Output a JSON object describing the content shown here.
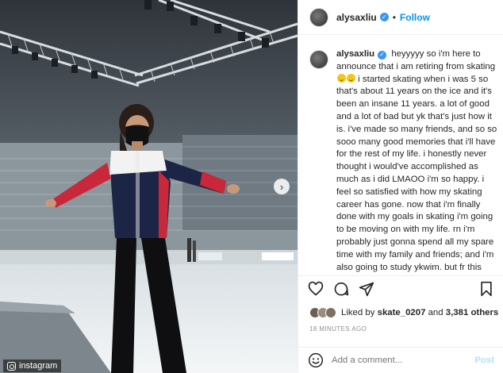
{
  "photo": {
    "watermark_text": "instagram",
    "carousel_icon": "chevron-right-icon",
    "arena_colors": {
      "roof": "#3a3f45",
      "seats": "#7f8a92",
      "ice": "#e4e9ec",
      "jacket_red": "#c8283a",
      "jacket_navy": "#1d2546",
      "jacket_white": "#f2f2f2"
    }
  },
  "post": {
    "username": "alysaxliu",
    "follow_label": "Follow",
    "separator": "•",
    "caption_part1": "heyyyyy so i'm here to announce that i am retiring from skating",
    "caption_part2": "i started skating when i was 5 so that's about 11 years on the ice and it's been an insane 11 years. a lot of good and a lot of bad but yk that's just how it is. i've made so many friends, and so so sooo many good memories that i'll have for the rest of my life. i honestly never thought i would've accomplished as much as i did LMAOO i'm so happy. i feel so satisfied with how my skating career has gone. now that i'm finally done with my goals in skating i'm going to be moving on with my life. rn i'm probably just gonna spend all my spare time with my family and friends; and i'm also going to study ykwim. but fr this skating thing has taught me a lot more",
    "liked_prefix": "Liked by",
    "liked_user": "skate_0207",
    "liked_and": "and",
    "liked_count": "3,381 others",
    "timestamp": "18 MINUTES AGO",
    "comment_placeholder": "Add a comment...",
    "post_label": "Post",
    "colors": {
      "accent": "#0095f6",
      "verified": "#3897f0",
      "post_disabled": "#b2dffc",
      "muted": "#8e8e8e"
    }
  }
}
